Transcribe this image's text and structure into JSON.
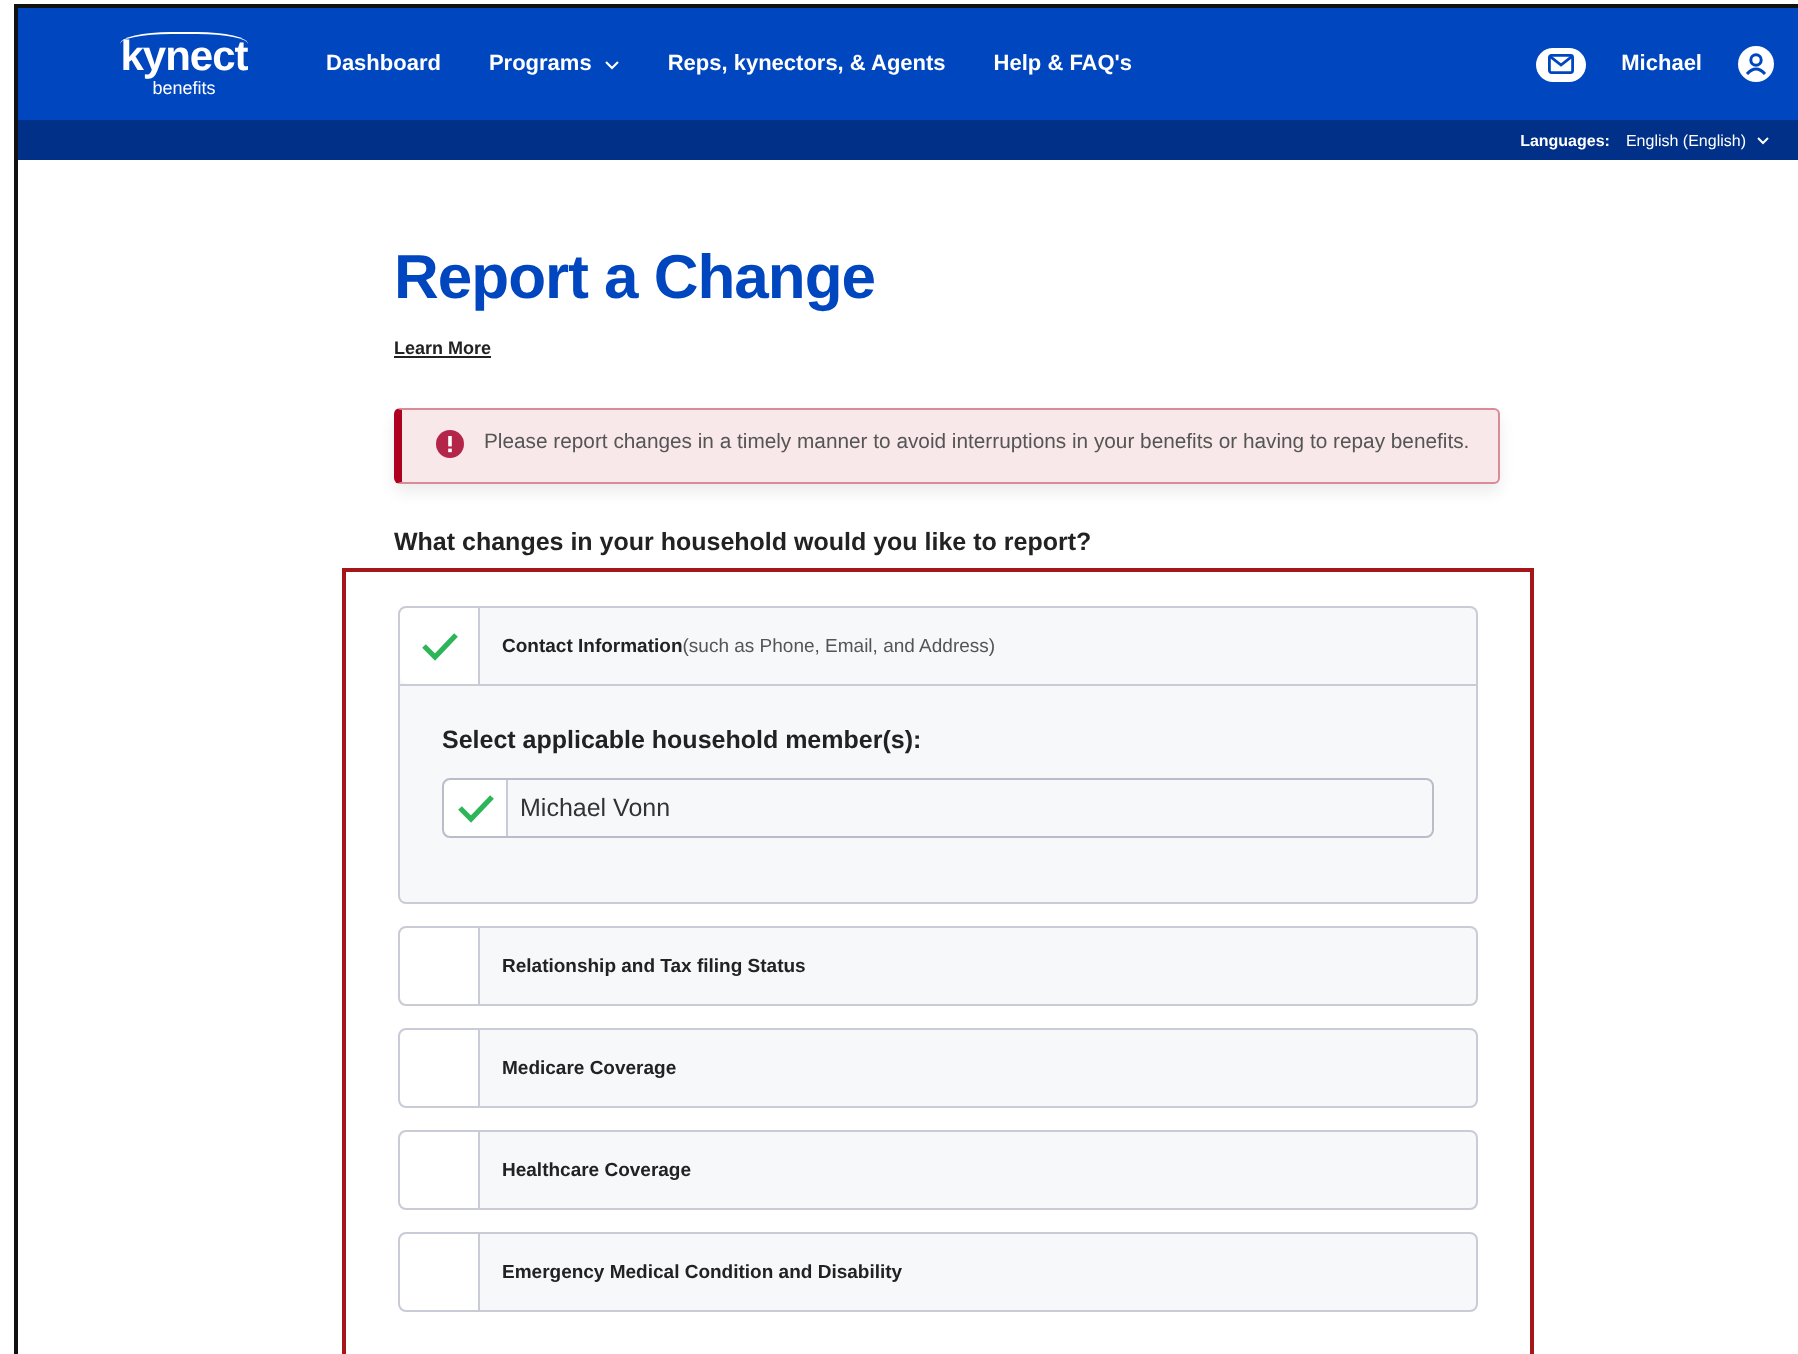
{
  "header": {
    "logo": "kynect",
    "logo_sub": "benefits",
    "nav": [
      {
        "label": "Dashboard",
        "dropdown": false
      },
      {
        "label": "Programs",
        "dropdown": true
      },
      {
        "label": "Reps, kynectors, & Agents",
        "dropdown": false
      },
      {
        "label": "Help & FAQ's",
        "dropdown": false
      }
    ],
    "user": "Michael",
    "languages_label": "Languages:",
    "language": "English (English)"
  },
  "page": {
    "title": "Report a Change",
    "learn_more": "Learn More",
    "alert": "Please report changes in a timely manner to avoid interruptions in your benefits or having to repay benefits.",
    "question": "What changes in your household would you like to report?",
    "options": [
      {
        "label": "Contact Information",
        "note": "(such as Phone, Email, and Address)",
        "checked": true,
        "expanded": true,
        "members_label": "Select applicable household member(s):",
        "members": [
          {
            "name": "Michael Vonn",
            "checked": true
          }
        ]
      },
      {
        "label": "Relationship and Tax filing Status",
        "checked": false,
        "expanded": false
      },
      {
        "label": "Medicare Coverage",
        "checked": false,
        "expanded": false
      },
      {
        "label": "Healthcare Coverage",
        "checked": false,
        "expanded": false
      },
      {
        "label": "Emergency Medical Condition and Disability",
        "checked": false,
        "expanded": false
      }
    ]
  }
}
